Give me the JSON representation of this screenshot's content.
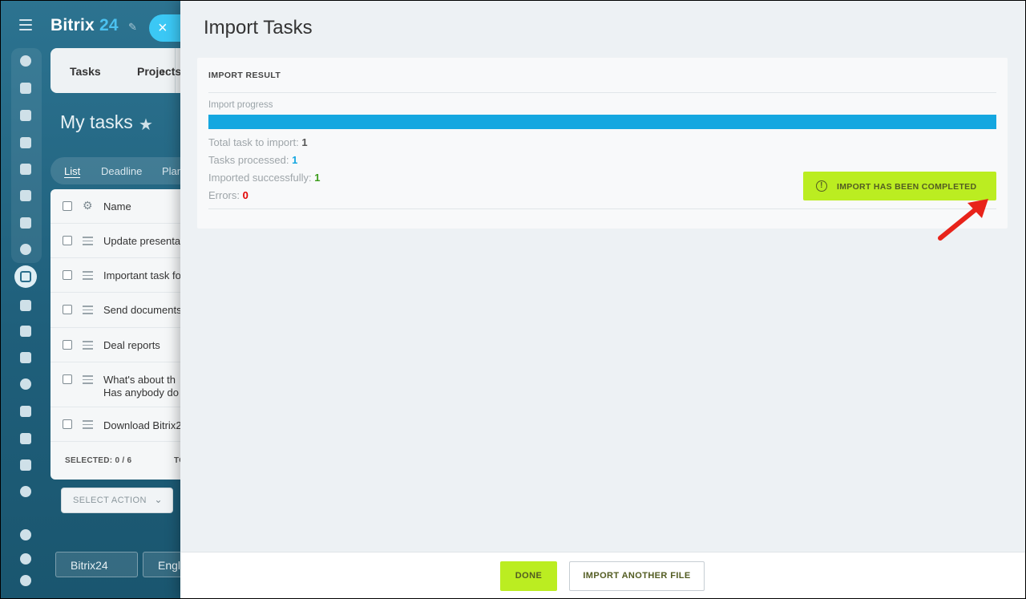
{
  "background": {
    "brand_name": "Bitrix",
    "brand_number": "24",
    "close_glyph": "×",
    "breadcrumb": {
      "item1": "Tasks",
      "separator": "›",
      "item2": "Projects"
    },
    "page_title": "My tasks",
    "view_tabs": [
      "List",
      "Deadline",
      "Plan"
    ],
    "table_header": "Name",
    "tasks": [
      "Update presentation",
      "Important task for",
      "Send documents",
      "Deal reports",
      "What's about th",
      "Download Bitrix2"
    ],
    "task5_line2": "Has anybody do",
    "selected_label": "SELECTED: 0 / 6",
    "total_label": "TO",
    "select_action": "SELECT ACTION",
    "footer_brand": "Bitrix24",
    "footer_lang": "English"
  },
  "slider": {
    "title": "Import Tasks",
    "section_heading": "IMPORT RESULT",
    "progress_label": "Import progress",
    "progress_fraction": 1.0,
    "stats": {
      "total_label": "Total task to import:",
      "total_value": "1",
      "processed_label": "Tasks processed:",
      "processed_value": "1",
      "imported_label": "Imported successfully:",
      "imported_value": "1",
      "errors_label": "Errors:",
      "errors_value": "0"
    },
    "status_badge": "IMPORT HAS BEEN COMPLETED",
    "status_icon": "!",
    "buttons": {
      "done": "DONE",
      "import_another": "IMPORT ANOTHER FILE"
    }
  },
  "colors": {
    "accent_green": "#bbed21",
    "progress_blue": "#15a7e0",
    "error_red": "#e20000",
    "success_green": "#3b9c1a",
    "annotation_arrow": "#e8231a"
  }
}
